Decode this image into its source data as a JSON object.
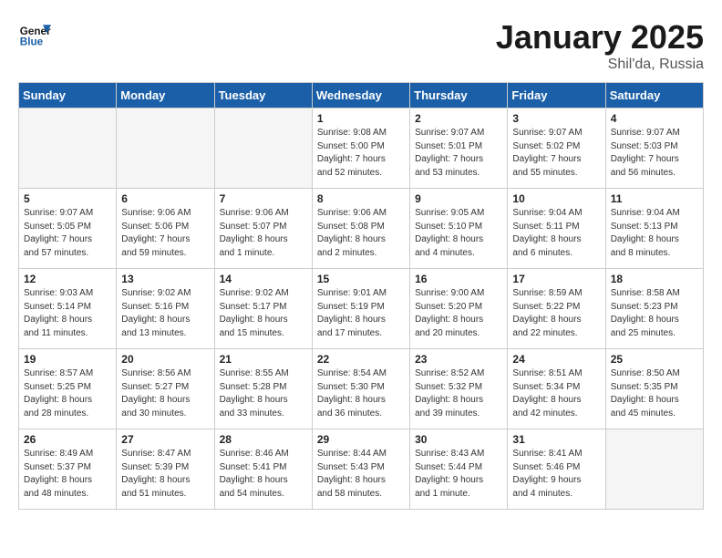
{
  "header": {
    "logo_general": "General",
    "logo_blue": "Blue",
    "month": "January 2025",
    "location": "Shil'da, Russia"
  },
  "weekdays": [
    "Sunday",
    "Monday",
    "Tuesday",
    "Wednesday",
    "Thursday",
    "Friday",
    "Saturday"
  ],
  "weeks": [
    [
      {
        "day": "",
        "info": ""
      },
      {
        "day": "",
        "info": ""
      },
      {
        "day": "",
        "info": ""
      },
      {
        "day": "1",
        "info": "Sunrise: 9:08 AM\nSunset: 5:00 PM\nDaylight: 7 hours\nand 52 minutes."
      },
      {
        "day": "2",
        "info": "Sunrise: 9:07 AM\nSunset: 5:01 PM\nDaylight: 7 hours\nand 53 minutes."
      },
      {
        "day": "3",
        "info": "Sunrise: 9:07 AM\nSunset: 5:02 PM\nDaylight: 7 hours\nand 55 minutes."
      },
      {
        "day": "4",
        "info": "Sunrise: 9:07 AM\nSunset: 5:03 PM\nDaylight: 7 hours\nand 56 minutes."
      }
    ],
    [
      {
        "day": "5",
        "info": "Sunrise: 9:07 AM\nSunset: 5:05 PM\nDaylight: 7 hours\nand 57 minutes."
      },
      {
        "day": "6",
        "info": "Sunrise: 9:06 AM\nSunset: 5:06 PM\nDaylight: 7 hours\nand 59 minutes."
      },
      {
        "day": "7",
        "info": "Sunrise: 9:06 AM\nSunset: 5:07 PM\nDaylight: 8 hours\nand 1 minute."
      },
      {
        "day": "8",
        "info": "Sunrise: 9:06 AM\nSunset: 5:08 PM\nDaylight: 8 hours\nand 2 minutes."
      },
      {
        "day": "9",
        "info": "Sunrise: 9:05 AM\nSunset: 5:10 PM\nDaylight: 8 hours\nand 4 minutes."
      },
      {
        "day": "10",
        "info": "Sunrise: 9:04 AM\nSunset: 5:11 PM\nDaylight: 8 hours\nand 6 minutes."
      },
      {
        "day": "11",
        "info": "Sunrise: 9:04 AM\nSunset: 5:13 PM\nDaylight: 8 hours\nand 8 minutes."
      }
    ],
    [
      {
        "day": "12",
        "info": "Sunrise: 9:03 AM\nSunset: 5:14 PM\nDaylight: 8 hours\nand 11 minutes."
      },
      {
        "day": "13",
        "info": "Sunrise: 9:02 AM\nSunset: 5:16 PM\nDaylight: 8 hours\nand 13 minutes."
      },
      {
        "day": "14",
        "info": "Sunrise: 9:02 AM\nSunset: 5:17 PM\nDaylight: 8 hours\nand 15 minutes."
      },
      {
        "day": "15",
        "info": "Sunrise: 9:01 AM\nSunset: 5:19 PM\nDaylight: 8 hours\nand 17 minutes."
      },
      {
        "day": "16",
        "info": "Sunrise: 9:00 AM\nSunset: 5:20 PM\nDaylight: 8 hours\nand 20 minutes."
      },
      {
        "day": "17",
        "info": "Sunrise: 8:59 AM\nSunset: 5:22 PM\nDaylight: 8 hours\nand 22 minutes."
      },
      {
        "day": "18",
        "info": "Sunrise: 8:58 AM\nSunset: 5:23 PM\nDaylight: 8 hours\nand 25 minutes."
      }
    ],
    [
      {
        "day": "19",
        "info": "Sunrise: 8:57 AM\nSunset: 5:25 PM\nDaylight: 8 hours\nand 28 minutes."
      },
      {
        "day": "20",
        "info": "Sunrise: 8:56 AM\nSunset: 5:27 PM\nDaylight: 8 hours\nand 30 minutes."
      },
      {
        "day": "21",
        "info": "Sunrise: 8:55 AM\nSunset: 5:28 PM\nDaylight: 8 hours\nand 33 minutes."
      },
      {
        "day": "22",
        "info": "Sunrise: 8:54 AM\nSunset: 5:30 PM\nDaylight: 8 hours\nand 36 minutes."
      },
      {
        "day": "23",
        "info": "Sunrise: 8:52 AM\nSunset: 5:32 PM\nDaylight: 8 hours\nand 39 minutes."
      },
      {
        "day": "24",
        "info": "Sunrise: 8:51 AM\nSunset: 5:34 PM\nDaylight: 8 hours\nand 42 minutes."
      },
      {
        "day": "25",
        "info": "Sunrise: 8:50 AM\nSunset: 5:35 PM\nDaylight: 8 hours\nand 45 minutes."
      }
    ],
    [
      {
        "day": "26",
        "info": "Sunrise: 8:49 AM\nSunset: 5:37 PM\nDaylight: 8 hours\nand 48 minutes."
      },
      {
        "day": "27",
        "info": "Sunrise: 8:47 AM\nSunset: 5:39 PM\nDaylight: 8 hours\nand 51 minutes."
      },
      {
        "day": "28",
        "info": "Sunrise: 8:46 AM\nSunset: 5:41 PM\nDaylight: 8 hours\nand 54 minutes."
      },
      {
        "day": "29",
        "info": "Sunrise: 8:44 AM\nSunset: 5:43 PM\nDaylight: 8 hours\nand 58 minutes."
      },
      {
        "day": "30",
        "info": "Sunrise: 8:43 AM\nSunset: 5:44 PM\nDaylight: 9 hours\nand 1 minute."
      },
      {
        "day": "31",
        "info": "Sunrise: 8:41 AM\nSunset: 5:46 PM\nDaylight: 9 hours\nand 4 minutes."
      },
      {
        "day": "",
        "info": ""
      }
    ]
  ]
}
